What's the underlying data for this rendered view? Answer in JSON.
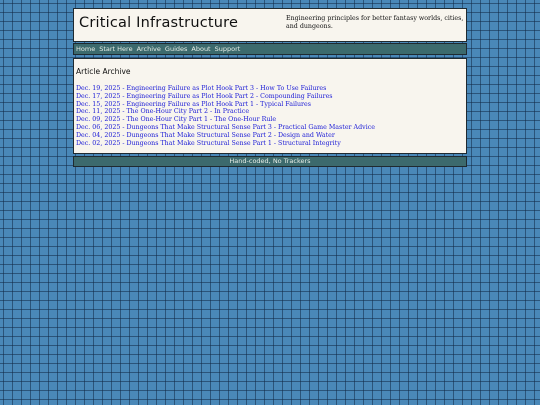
{
  "site": {
    "title": "Critical Infrastructure",
    "tagline": "Engineering principles for better fantasy worlds, cities, and dungeons."
  },
  "nav": {
    "items": [
      {
        "label": "Home"
      },
      {
        "label": "Start Here"
      },
      {
        "label": "Archive"
      },
      {
        "label": "Guides"
      },
      {
        "label": "About"
      },
      {
        "label": "Support"
      }
    ]
  },
  "archive": {
    "heading": "Article Archive",
    "articles": [
      {
        "label": "Dec. 19, 2025 - Engineering Failure as Plot Hook Part 3 - How To Use Failures"
      },
      {
        "label": "Dec. 17, 2025 - Engineering Failure as Plot Hook Part 2 - Compounding Failures"
      },
      {
        "label": "Dec. 15, 2025 - Engineering Failure as Plot Hook Part 1 - Typical Failures"
      },
      {
        "label": "Dec. 11, 2025 - The One-Hour City Part 2 - In Practice"
      },
      {
        "label": "Dec. 09, 2025 - The One-Hour City Part 1 - The One-Hour Rule"
      },
      {
        "label": "Dec. 06, 2025 - Dungeons That Make Structural Sense Part 3 - Practical Game Master Advice"
      },
      {
        "label": "Dec. 04, 2025 - Dungeons That Make Structural Sense Part 2 - Design and Water"
      },
      {
        "label": "Dec. 02, 2025 - Dungeons That Make Structural Sense Part 1 - Structural Integrity"
      }
    ]
  },
  "footer": {
    "text": "Hand-coded, No Trackers"
  }
}
